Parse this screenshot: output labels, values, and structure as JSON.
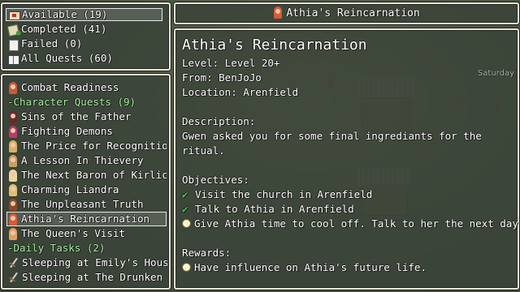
{
  "window_title": "Athia's Reincarnation",
  "categories": [
    {
      "label": "Available (19)",
      "icon": "red-seal-scroll-icon",
      "selected": true
    },
    {
      "label": "Completed (41)",
      "icon": "green-scroll-icon",
      "selected": false
    },
    {
      "label": "Failed (0)",
      "icon": "page-icon",
      "selected": false
    },
    {
      "label": "All Quests (60)",
      "icon": "open-book-icon",
      "selected": false
    }
  ],
  "quest_list": [
    {
      "label": "Combat Readiness",
      "type": "quest",
      "icon": "portrait-icon",
      "color": "#c85a3a"
    },
    {
      "label": "-Character Quests (9)",
      "type": "header"
    },
    {
      "label": "Sins of the Father",
      "type": "quest",
      "icon": "portrait-icon",
      "color": "#6a2a2a"
    },
    {
      "label": "Fighting Demons",
      "type": "quest",
      "icon": "portrait-icon",
      "color": "#b83a6a"
    },
    {
      "label": "The Price for Recognitio",
      "type": "quest",
      "icon": "portrait-icon",
      "color": "#d8b060"
    },
    {
      "label": "A Lesson In Thievery",
      "type": "quest",
      "icon": "portrait-icon",
      "color": "#c8a060"
    },
    {
      "label": "The Next Baron of Kirlic",
      "type": "quest",
      "icon": "portrait-icon",
      "color": "#e8d8a0"
    },
    {
      "label": "Charming Liandra",
      "type": "quest",
      "icon": "portrait-icon",
      "color": "#e0c070"
    },
    {
      "label": "The Unpleasant Truth",
      "type": "quest",
      "icon": "portrait-icon",
      "color": "#8a4a2a"
    },
    {
      "label": "Athia's Reincarnation",
      "type": "quest",
      "icon": "portrait-icon",
      "color": "#d85a3a",
      "selected": true
    },
    {
      "label": "The Queen's Visit",
      "type": "quest",
      "icon": "portrait-icon",
      "color": "#e0a060"
    },
    {
      "label": "-Daily Tasks (2)",
      "type": "header"
    },
    {
      "label": "Sleeping at Emily's Hous",
      "type": "task",
      "icon": "sword-icon"
    },
    {
      "label": "Sleeping at The Drunken",
      "type": "task",
      "icon": "sword-icon"
    }
  ],
  "detail": {
    "title": "Athia's Reincarnation",
    "level_line": "Level: Level 20+",
    "from_line": "From: BenJoJo",
    "location_line": "Location: Arenfield",
    "description_label": "Description:",
    "description_lines": [
      "Gwen asked you for some final ingrediants for the",
      "ritual."
    ],
    "objectives_label": "Objectives:",
    "objectives": [
      {
        "text": "Visit the church in Arenfield",
        "status": "done"
      },
      {
        "text": "Talk to Athia in Arenfield",
        "status": "done"
      },
      {
        "text": "Give Athia time to cool off. Talk to her the next day.",
        "status": "pending"
      }
    ],
    "rewards_label": "Rewards:",
    "rewards": [
      {
        "text": "Have influence on Athia's future life."
      }
    ]
  },
  "background_text": "Saturday"
}
